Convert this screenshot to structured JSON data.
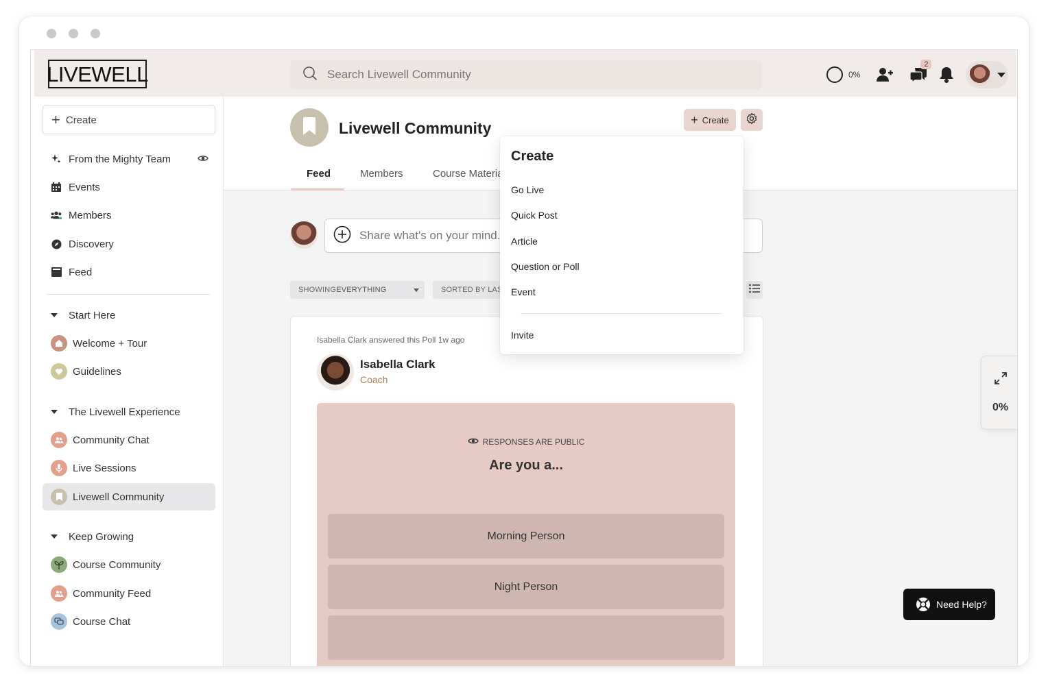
{
  "header": {
    "logo_text": "LIVEWELL",
    "search_placeholder": "Search Livewell Community",
    "progress_percent": "0%",
    "messages_badge": "2"
  },
  "sidebar": {
    "create_label": "Create",
    "top_items": [
      {
        "label": "From the Mighty Team",
        "icon": "sparkle-icon"
      },
      {
        "label": "Events",
        "icon": "calendar-icon"
      },
      {
        "label": "Members",
        "icon": "members-icon"
      },
      {
        "label": "Discovery",
        "icon": "compass-icon"
      },
      {
        "label": "Feed",
        "icon": "feed-icon"
      }
    ],
    "sections": [
      {
        "title": "Start Here",
        "items": [
          {
            "label": "Welcome + Tour",
            "color": "#c99282"
          },
          {
            "label": "Guidelines",
            "color": "#cdc79c"
          }
        ]
      },
      {
        "title": "The Livewell Experience",
        "items": [
          {
            "label": "Community Chat",
            "color": "#e3a18d"
          },
          {
            "label": "Live Sessions",
            "color": "#e3a18d"
          },
          {
            "label": "Livewell Community",
            "color": "#c7c0ac",
            "active": true
          }
        ]
      },
      {
        "title": "Keep Growing",
        "items": [
          {
            "label": "Course Community",
            "color": "#8cab7c"
          },
          {
            "label": "Community Feed",
            "color": "#e3a18d"
          },
          {
            "label": "Course Chat",
            "color": "#a9c3db"
          }
        ]
      }
    ]
  },
  "main": {
    "title": "Livewell Community",
    "create_label": "Create",
    "tabs": [
      "Feed",
      "Members",
      "Course Materia"
    ],
    "composer_placeholder": "Share what's on your mind...",
    "filter_showing_prefix": "SHOWING ",
    "filter_showing_value": "EVERYTHING",
    "filter_sorted": "SORTED BY LAST"
  },
  "post": {
    "meta": "Isabella Clark answered this Poll 1w ago",
    "author": "Isabella Clark",
    "role": "Coach",
    "poll_note": "RESPONSES ARE PUBLIC",
    "poll_question": "Are you a...",
    "options": [
      "Morning Person",
      "Night Person"
    ]
  },
  "dropdown": {
    "title": "Create",
    "items": [
      "Go Live",
      "Quick Post",
      "Article",
      "Question or Poll",
      "Event"
    ],
    "invite": "Invite"
  },
  "side_widget": {
    "percent": "0%"
  },
  "help": {
    "label": "Need Help?"
  },
  "colors": {
    "header_bg": "#f1ece9",
    "accent": "#ead4cf",
    "poll_bg": "#e6cbc5",
    "poll_option": "#cfb6b1",
    "active_nav": "#e8e8ea"
  }
}
